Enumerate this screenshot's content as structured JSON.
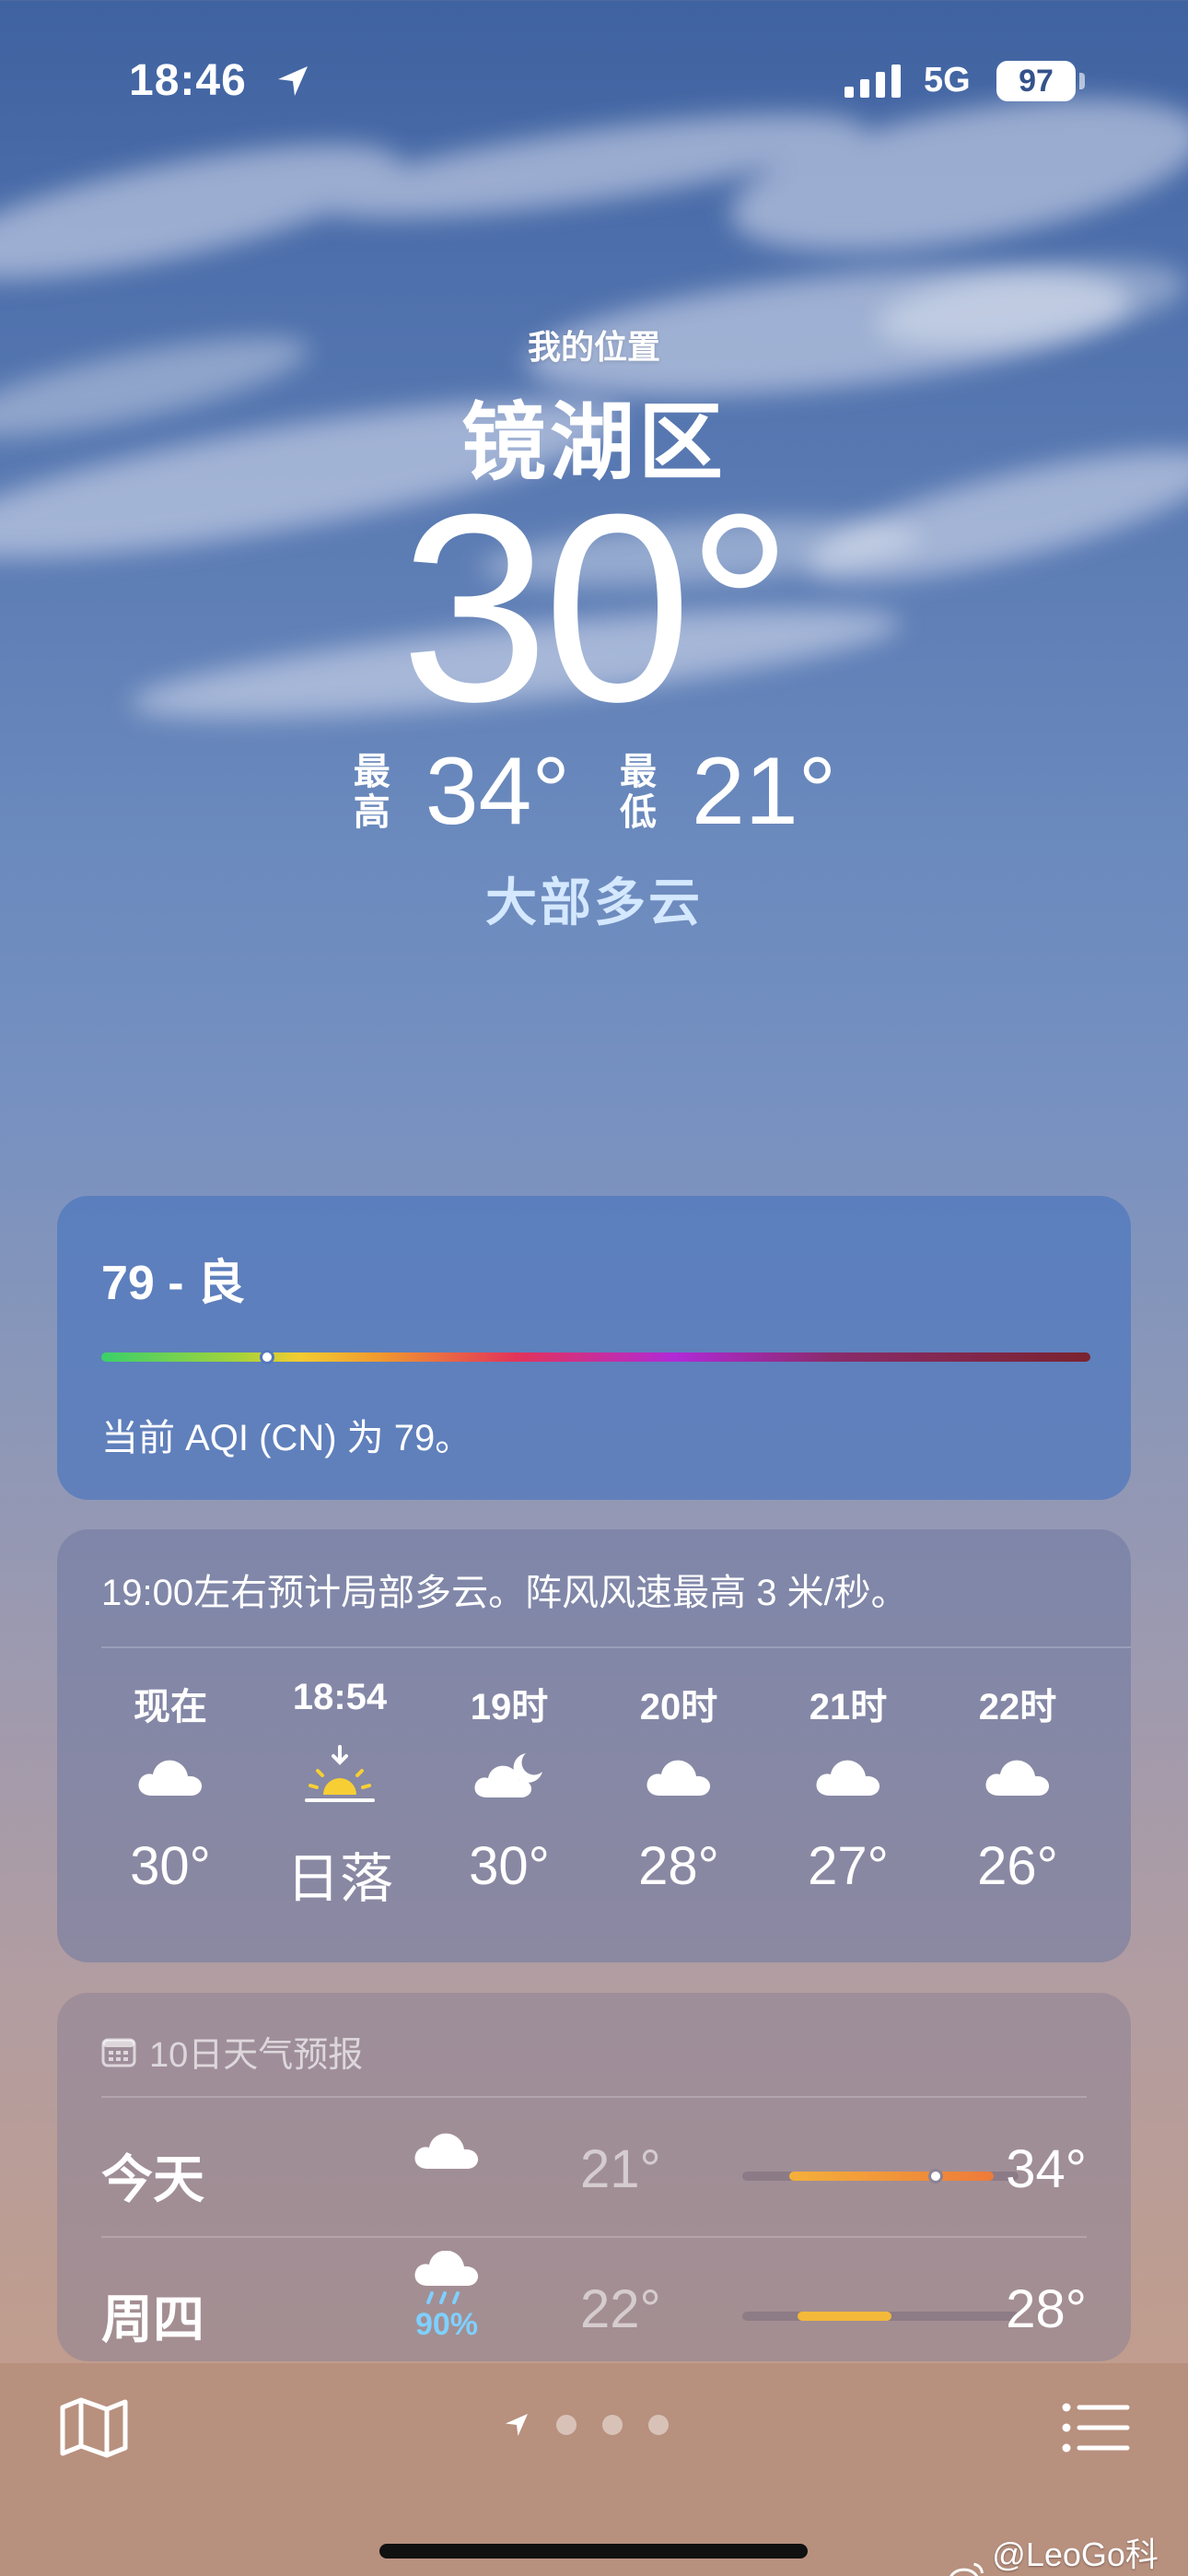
{
  "status_bar": {
    "time": "18:46",
    "network": "5G",
    "battery": "97"
  },
  "header": {
    "location_label": "我的位置",
    "city": "镜湖区",
    "current_temp": "30°",
    "high_label": "最高",
    "high": "34°",
    "low_label": "最低",
    "low": "21°",
    "condition": "大部多云"
  },
  "aqi": {
    "title": "79 - 良",
    "level": 79,
    "description": "当前 AQI (CN) 为 79。"
  },
  "hourly": {
    "summary": "19:00左右预计局部多云。阵风风速最高 3 米/秒。",
    "hours": [
      {
        "label": "现在",
        "icon": "cloud-icon",
        "temp": "30°"
      },
      {
        "label": "18:54",
        "icon": "sunset-icon",
        "temp": "日落"
      },
      {
        "label": "19时",
        "icon": "cloud-moon-icon",
        "temp": "30°"
      },
      {
        "label": "20时",
        "icon": "cloud-icon",
        "temp": "28°"
      },
      {
        "label": "21时",
        "icon": "cloud-icon",
        "temp": "27°"
      },
      {
        "label": "22时",
        "icon": "cloud-icon",
        "temp": "26°"
      }
    ]
  },
  "forecast": {
    "title": "10日天气预报",
    "days": [
      {
        "day": "今天",
        "icon": "cloud-icon",
        "precip": "",
        "low": "21°",
        "high": "34°",
        "range_start": 0.17,
        "range_end": 0.91,
        "current_marker": 0.7
      },
      {
        "day": "周四",
        "icon": "cloud-rain-icon",
        "precip": "90%",
        "low": "22°",
        "high": "28°",
        "range_start": 0.2,
        "range_end": 0.54,
        "current_marker": null
      }
    ]
  },
  "colors": {
    "aqi_gradient": [
      "#3ad06a",
      "#f2cc31",
      "#e2335a",
      "#b02ad6",
      "#7a2330"
    ],
    "condition_text": "#d4e8ff",
    "precip_text": "#7fd0ff",
    "today_range": [
      "#f4b03a",
      "#ee7a3a"
    ],
    "thursday_range": "#f4b93a"
  },
  "bottom_bar": {
    "map_icon": "map-icon",
    "location_icon": "location-arrow-icon",
    "list_icon": "list-icon",
    "pages": 4
  },
  "watermark": "@LeoGo科技"
}
